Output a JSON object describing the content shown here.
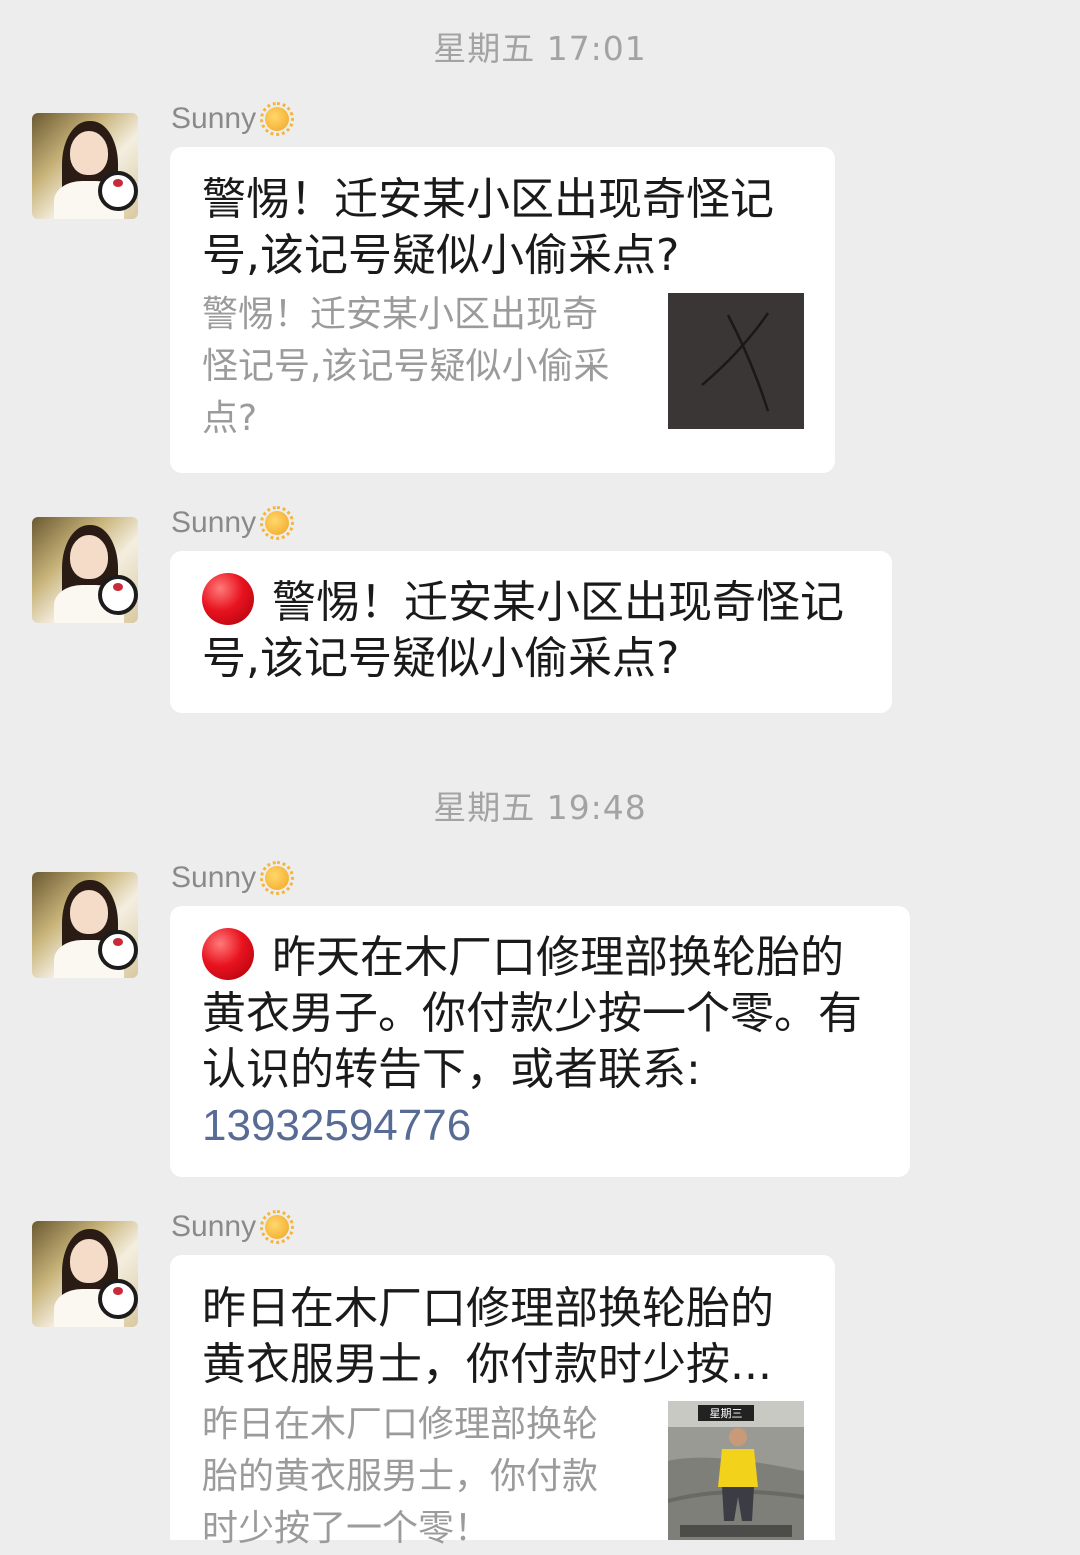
{
  "timestamps": [
    "星期五 17:01",
    "星期五 19:48"
  ],
  "sender_name": "Sunny",
  "messages": [
    {
      "type": "link",
      "title": "警惕！迁安某小区出现奇怪记号,该记号疑似小偷采点?",
      "description": "警惕！迁安某小区出现奇怪记号,该记号疑似小偷采点?",
      "thumbnail": "x-mark-photo"
    },
    {
      "type": "text",
      "icon": "red-circle-emoji",
      "text": "警惕！迁安某小区出现奇怪记号,该记号疑似小偷采点?"
    },
    {
      "type": "text",
      "icon": "red-circle-emoji",
      "text": "昨天在木厂口修理部换轮胎的黄衣男子。你付款少按一个零。有认识的转告下，或者联系:",
      "phone": "13932594776"
    },
    {
      "type": "link",
      "title": "昨日在木厂口修理部换轮胎的黄衣服男士，你付款时少按...",
      "description": "昨日在木厂口修理部换轮胎的黄衣服男士，你付款时少按了一个零！",
      "thumbnail": "man-yellow-shirt-photo",
      "thumbnail_caption": "星期三"
    }
  ],
  "colors": {
    "background": "#ededed",
    "bubble": "#ffffff",
    "link": "#576b95",
    "secondary_text": "#9b9b9b"
  }
}
